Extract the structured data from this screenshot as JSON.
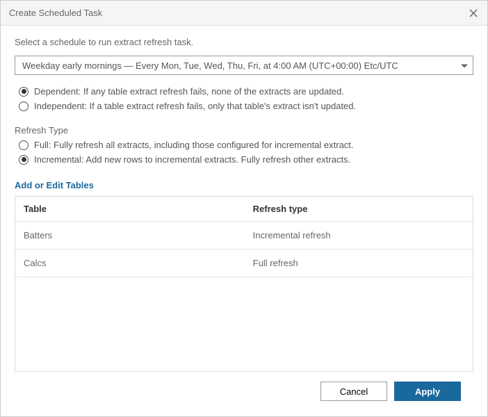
{
  "dialog": {
    "title": "Create Scheduled Task",
    "subtitle": "Select a schedule to run extract refresh task."
  },
  "schedule": {
    "selected": "Weekday early mornings — Every Mon, Tue, Wed, Thu, Fri, at 4:00 AM (UTC+00:00) Etc/UTC"
  },
  "dependency": {
    "options": [
      {
        "label": "Dependent: If any table extract refresh fails, none of the extracts are updated.",
        "selected": true
      },
      {
        "label": "Independent: If a table extract refresh fails, only that table's extract isn't updated.",
        "selected": false
      }
    ]
  },
  "refresh_type": {
    "section_label": "Refresh Type",
    "options": [
      {
        "label": "Full: Fully refresh all extracts, including those configured for incremental extract.",
        "selected": false
      },
      {
        "label": "Incremental: Add new rows to incremental extracts. Fully refresh other extracts.",
        "selected": true
      }
    ]
  },
  "tables_link": "Add or Edit Tables",
  "table": {
    "headers": {
      "table": "Table",
      "type": "Refresh type"
    },
    "rows": [
      {
        "name": "Batters",
        "type": "Incremental refresh"
      },
      {
        "name": "Calcs",
        "type": "Full refresh"
      }
    ]
  },
  "buttons": {
    "cancel": "Cancel",
    "apply": "Apply"
  }
}
